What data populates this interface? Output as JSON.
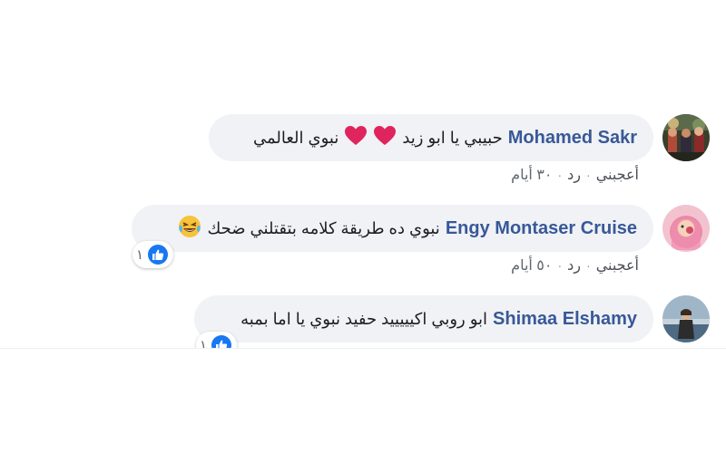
{
  "comments": [
    {
      "author": "Mohamed Sakr",
      "text_before": "حبيبي يا ابو زيد",
      "text_after": "نبوي العالمي",
      "emojis": [
        "heart-emoji",
        "heart-emoji"
      ],
      "like_label": "أعجبني",
      "separator": "·",
      "reply_label": "رد",
      "time": "٣٠ أيام",
      "reactions": null
    },
    {
      "author": "Engy Montaser Cruise",
      "text_before": "نبوي ده طريقة كلامه بتقتلني ضحك",
      "text_after": "",
      "emojis": [
        "laughing-emoji"
      ],
      "like_label": "أعجبني",
      "separator": "·",
      "reply_label": "رد",
      "time": "٥٠ أيام",
      "reactions": "١"
    },
    {
      "author": "Shimaa Elshamy",
      "text_before": "ابو روبي اكيييييد حفيد نبوي يا اما بمبه",
      "text_after": "",
      "emojis": [],
      "reactions": "١"
    }
  ],
  "colors": {
    "author": "#385898",
    "bubble": "#f0f2f5",
    "like_blue": "#1877f2",
    "heart_red": "#e0245e"
  }
}
